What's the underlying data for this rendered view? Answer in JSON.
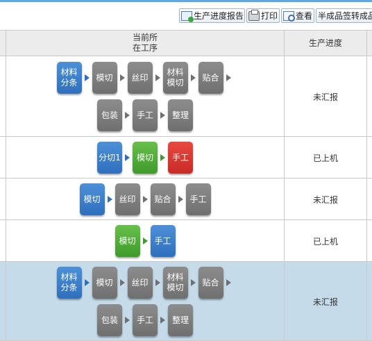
{
  "toolbar": {
    "buttons": [
      {
        "label": "生产进度报告",
        "icon": "report-icon"
      },
      {
        "label": "打印",
        "icon": "print-icon"
      },
      {
        "label": "查看",
        "icon": "view-icon"
      },
      {
        "label": "半成品签转成品",
        "icon": ""
      }
    ]
  },
  "table": {
    "headers": {
      "process": "当前所\n在工序",
      "progress": "生产进度"
    },
    "rows": [
      {
        "selected": false,
        "steps": [
          {
            "label": "材料\n分条",
            "color": "blue"
          },
          {
            "label": "模切",
            "color": "gray"
          },
          {
            "label": "丝印",
            "color": "gray"
          },
          {
            "label": "材料\n模切",
            "color": "gray"
          },
          {
            "label": "贴合",
            "color": "gray"
          },
          {
            "label": "包装",
            "color": "gray"
          },
          {
            "label": "手工",
            "color": "gray"
          },
          {
            "label": "整理",
            "color": "gray"
          }
        ],
        "status": "未汇报"
      },
      {
        "selected": false,
        "steps": [
          {
            "label": "分切1",
            "color": "blue"
          },
          {
            "label": "模切",
            "color": "green"
          },
          {
            "label": "手工",
            "color": "red"
          }
        ],
        "status": "已上机"
      },
      {
        "selected": false,
        "steps": [
          {
            "label": "模切",
            "color": "blue"
          },
          {
            "label": "丝印",
            "color": "gray"
          },
          {
            "label": "贴合",
            "color": "gray"
          },
          {
            "label": "手工",
            "color": "gray"
          }
        ],
        "status": "未汇报"
      },
      {
        "selected": false,
        "steps": [
          {
            "label": "模切",
            "color": "green"
          },
          {
            "label": "手工",
            "color": "blue"
          }
        ],
        "status": "已上机"
      },
      {
        "selected": true,
        "steps": [
          {
            "label": "材料\n分条",
            "color": "blue"
          },
          {
            "label": "模切",
            "color": "gray"
          },
          {
            "label": "丝印",
            "color": "gray"
          },
          {
            "label": "材料\n模切",
            "color": "gray"
          },
          {
            "label": "贴合",
            "color": "gray"
          },
          {
            "label": "包装",
            "color": "gray"
          },
          {
            "label": "手工",
            "color": "gray"
          },
          {
            "label": "整理",
            "color": "gray"
          }
        ],
        "status": "未汇报"
      }
    ]
  }
}
